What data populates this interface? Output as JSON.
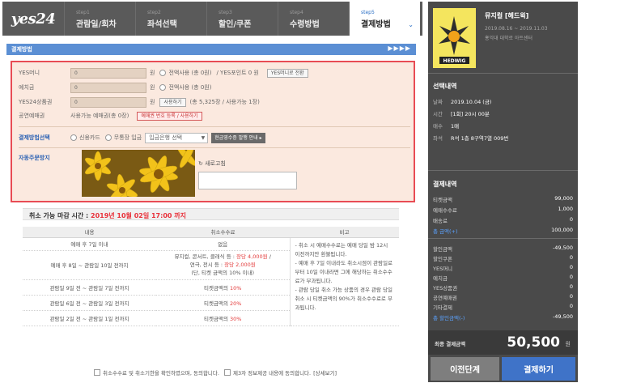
{
  "brand": {
    "logo": "yes24"
  },
  "steps": [
    {
      "num": "step1",
      "label": "관람일/회차"
    },
    {
      "num": "step2",
      "label": "좌석선택"
    },
    {
      "num": "step3",
      "label": "할인/쿠폰"
    },
    {
      "num": "step4",
      "label": "수령방법"
    },
    {
      "num": "step5",
      "label": "결제방법"
    }
  ],
  "section": {
    "title": "결제방법",
    "arrows": "▶▶▶▶"
  },
  "payment": {
    "yesmoney": {
      "label": "YES머니",
      "value": "0",
      "unit": "원",
      "use_all": "전액사용 (총 0원)",
      "points": "/ YES포인트 0 원",
      "convert_btn": "YES머니로 전환"
    },
    "deposit": {
      "label": "예치금",
      "value": "0",
      "unit": "원",
      "use_all": "전액사용 (총 0원)"
    },
    "giftcard": {
      "label": "YES24상품권",
      "value": "0",
      "unit": "원",
      "use_btn": "사용하기",
      "info": "(총 5,325장 / 사용가능 1장)"
    },
    "voucher": {
      "label": "공연예매권",
      "info": "사용가능 예매권(총 0장)",
      "register_btn": "예매권 번호 등록 / 사용하기"
    },
    "method": {
      "label": "결제방법선택",
      "card": "신용카드",
      "bank": "무통장 입금",
      "bank_select": "입금은행 선택",
      "receipt_btn": "현금영수증 발행 안내 ▸"
    },
    "captcha": {
      "label": "자동주문방지",
      "refresh": "새로고침"
    }
  },
  "deadline": {
    "prefix": "취소 가능 마감 시간 : ",
    "value": "2019년 10월 02일 17:00 까지"
  },
  "cancel_table": {
    "headers": [
      "내용",
      "취소수수료",
      "비고"
    ],
    "rows": [
      {
        "period": "예매 후 7일 이내",
        "fee": "없음"
      },
      {
        "period": "예매 후 8일 ~ 관람일 10일 전까지",
        "fee1": "뮤지컬, 콘서트, 클래식 등 : ",
        "fee1r": "장당 4,000원",
        "fee1b": " /",
        "fee2": "연극, 전시 등 : ",
        "fee2r": "장당 2,000원",
        "fee3": "(단, 티켓 금액의 10% 이내)"
      },
      {
        "period": "관람일 9일 전 ~ 관람일 7일 전까지",
        "fee": "티켓금액의 ",
        "feer": "10%"
      },
      {
        "period": "관람일 6일 전 ~ 관람일 3일 전까지",
        "fee": "티켓금액의 ",
        "feer": "20%"
      },
      {
        "period": "관람일 2일 전 ~ 관람일 1일 전까지",
        "fee": "티켓금액의 ",
        "feer": "30%"
      }
    ],
    "notes": [
      "- 취소 시 예매수수료는 예매 당일 밤 12시 이전까지만 환불됩니다.",
      "- 예매 후 7일 이내라도 취소시점이 관람일로부터 10일 이내라면 그에 해당하는 취소수수료가 부과됩니다.",
      "- 관람 당일 취소 가능 상품의 경우 관람 당일 취소 시 티켓금액의 90%가 취소수수료로 부과됩니다."
    ]
  },
  "agree": {
    "a1": "취소수수료 및 취소기한을 확인하였으며, 동의합니다.",
    "a2": "제3자 정보제공 내용에 동의합니다.",
    "a3": "[상세보기]"
  },
  "show": {
    "title": "뮤지컬 [헤드윅]",
    "dates": "2019.08.16 ~ 2019.11.03",
    "venue": "홍익대 대학로 아트센터",
    "poster_text": "HEDWIG"
  },
  "selection": {
    "title": "선택내역",
    "items": [
      {
        "k": "날짜",
        "v": "2019.10.04 (금)"
      },
      {
        "k": "시간",
        "v": "[1회] 20시 00분"
      },
      {
        "k": "매수",
        "v": "1매"
      },
      {
        "k": "좌석",
        "v": "R석 1층 8구역7열 009번"
      }
    ]
  },
  "summary": {
    "title": "결제내역",
    "rows": [
      {
        "k": "티켓금액",
        "v": "99,000"
      },
      {
        "k": "예매수수료",
        "v": "1,000"
      },
      {
        "k": "배송료",
        "v": "0"
      },
      {
        "k": "총 금액(+)",
        "v": "100,000",
        "blue": true
      }
    ],
    "discounts": [
      {
        "k": "할인금액",
        "v": "-49,500"
      },
      {
        "k": "할인쿠폰",
        "v": "0"
      },
      {
        "k": "YES머니",
        "v": "0"
      },
      {
        "k": "예치금",
        "v": "0"
      },
      {
        "k": "YES상품권",
        "v": "0"
      },
      {
        "k": "공연예매권",
        "v": "0"
      },
      {
        "k": "기타결제",
        "v": "0"
      },
      {
        "k": "총 할인금액(-)",
        "v": "-49,500",
        "blue": true
      }
    ],
    "final_label": "최종 결제금액",
    "final_amount": "50,500",
    "final_unit": "원"
  },
  "buttons": {
    "prev": "이전단계",
    "pay": "결제하기"
  }
}
